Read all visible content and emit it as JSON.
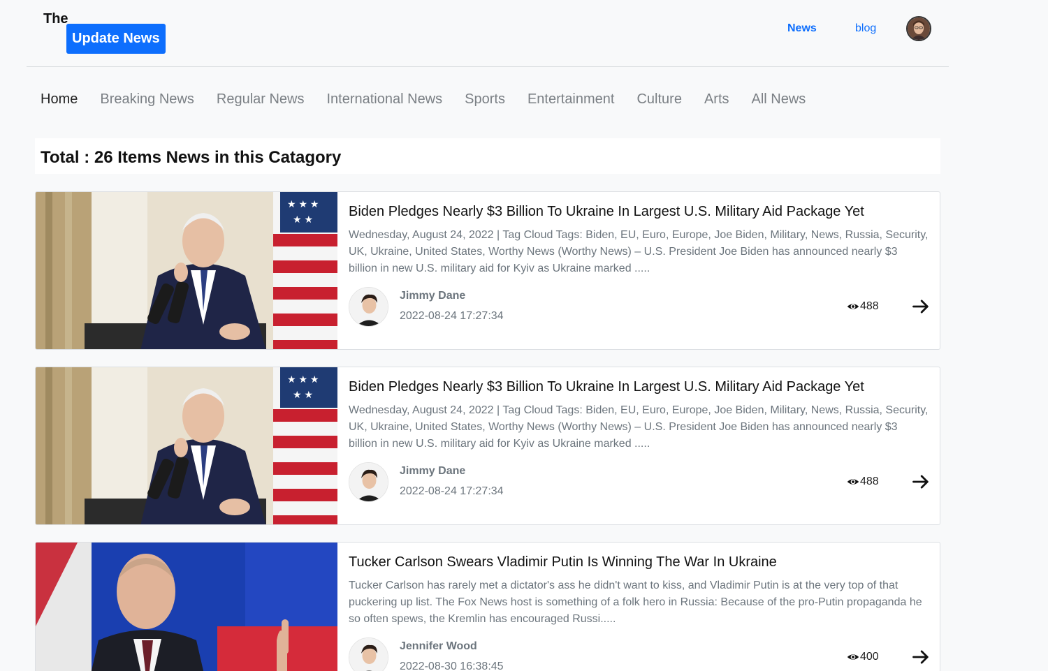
{
  "header": {
    "logo_the": "The",
    "logo_badge": "Update News",
    "links": {
      "news": "News",
      "blog": "blog"
    }
  },
  "category_nav": [
    "Home",
    "Breaking News",
    "Regular News",
    "International News",
    "Sports",
    "Entertainment",
    "Culture",
    "Arts",
    "All News"
  ],
  "total_heading": "Total : 26 Items News in this Catagory",
  "articles": [
    {
      "title": "Biden Pledges Nearly $3 Billion To Ukraine In Largest U.S. Military Aid Package Yet",
      "description": "Wednesday, August 24, 2022 | Tag Cloud Tags: Biden, EU, Euro, Europe, Joe Biden, Military, News, Russia, Security, UK, Ukraine, United States, Worthy News (Worthy News) – U.S. President Joe Biden has announced nearly $3 billion in new U.S. military aid for Kyiv as Ukraine marked .....",
      "author": "Jimmy Dane",
      "date": "2022-08-24 17:27:34",
      "views": "488"
    },
    {
      "title": "Biden Pledges Nearly $3 Billion To Ukraine In Largest U.S. Military Aid Package Yet",
      "description": "Wednesday, August 24, 2022 | Tag Cloud Tags: Biden, EU, Euro, Europe, Joe Biden, Military, News, Russia, Security, UK, Ukraine, United States, Worthy News (Worthy News) – U.S. President Joe Biden has announced nearly $3 billion in new U.S. military aid for Kyiv as Ukraine marked .....",
      "author": "Jimmy Dane",
      "date": "2022-08-24 17:27:34",
      "views": "488"
    },
    {
      "title": "Tucker Carlson Swears Vladimir Putin Is Winning The War In Ukraine",
      "description": "Tucker Carlson has rarely met a dictator's ass he didn't want to kiss, and Vladimir Putin is at the very top of that puckering up list. The Fox News host is something of a folk hero in Russia: Because of the pro-Putin propaganda he so often spews, the Kremlin has encouraged Russi.....",
      "author": "Jennifer Wood",
      "date": "2022-08-30 16:38:45",
      "views": "400"
    }
  ]
}
